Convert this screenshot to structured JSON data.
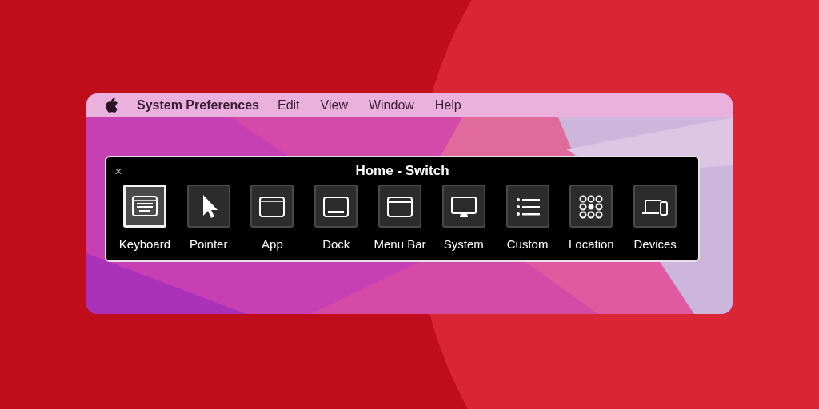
{
  "menu_bar": {
    "app_name": "System Preferences",
    "menus": [
      "Edit",
      "View",
      "Window",
      "Help"
    ]
  },
  "panel": {
    "close": "×",
    "minimize": "–",
    "title": "Home - Switch",
    "items": [
      {
        "label": "Keyboard",
        "kind": "keyboard",
        "selected": true
      },
      {
        "label": "Pointer",
        "kind": "pointer",
        "selected": false
      },
      {
        "label": "App",
        "kind": "app",
        "selected": false
      },
      {
        "label": "Dock",
        "kind": "dock",
        "selected": false
      },
      {
        "label": "Menu Bar",
        "kind": "menubar",
        "selected": false
      },
      {
        "label": "System",
        "kind": "system",
        "selected": false
      },
      {
        "label": "Custom",
        "kind": "custom",
        "selected": false
      },
      {
        "label": "Location",
        "kind": "location",
        "selected": false
      },
      {
        "label": "Devices",
        "kind": "devices",
        "selected": false
      }
    ]
  }
}
